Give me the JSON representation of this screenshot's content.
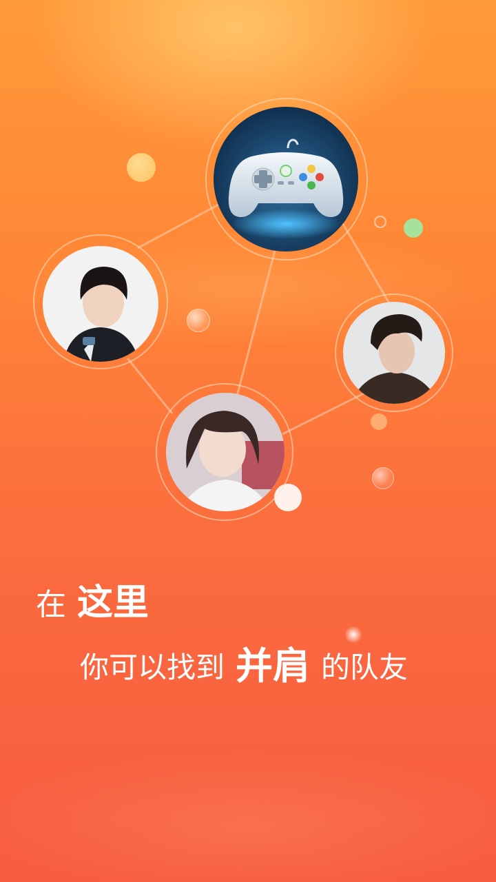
{
  "headline": {
    "line1_prefix": "在",
    "line1_emphasis": "这里",
    "line2_prefix": "你可以找到",
    "line2_emphasis": "并肩",
    "line2_suffix": "的队友"
  },
  "avatars": [
    {
      "name": "gamepad-icon"
    },
    {
      "name": "avatar-player-1"
    },
    {
      "name": "avatar-player-2"
    },
    {
      "name": "avatar-player-3"
    }
  ],
  "colors": {
    "background_top": "#ff9a3a",
    "background_bottom": "#f75a40",
    "text": "#ffffff",
    "bubble_yellow": "#ffd277",
    "bubble_green": "#a6e29a"
  }
}
